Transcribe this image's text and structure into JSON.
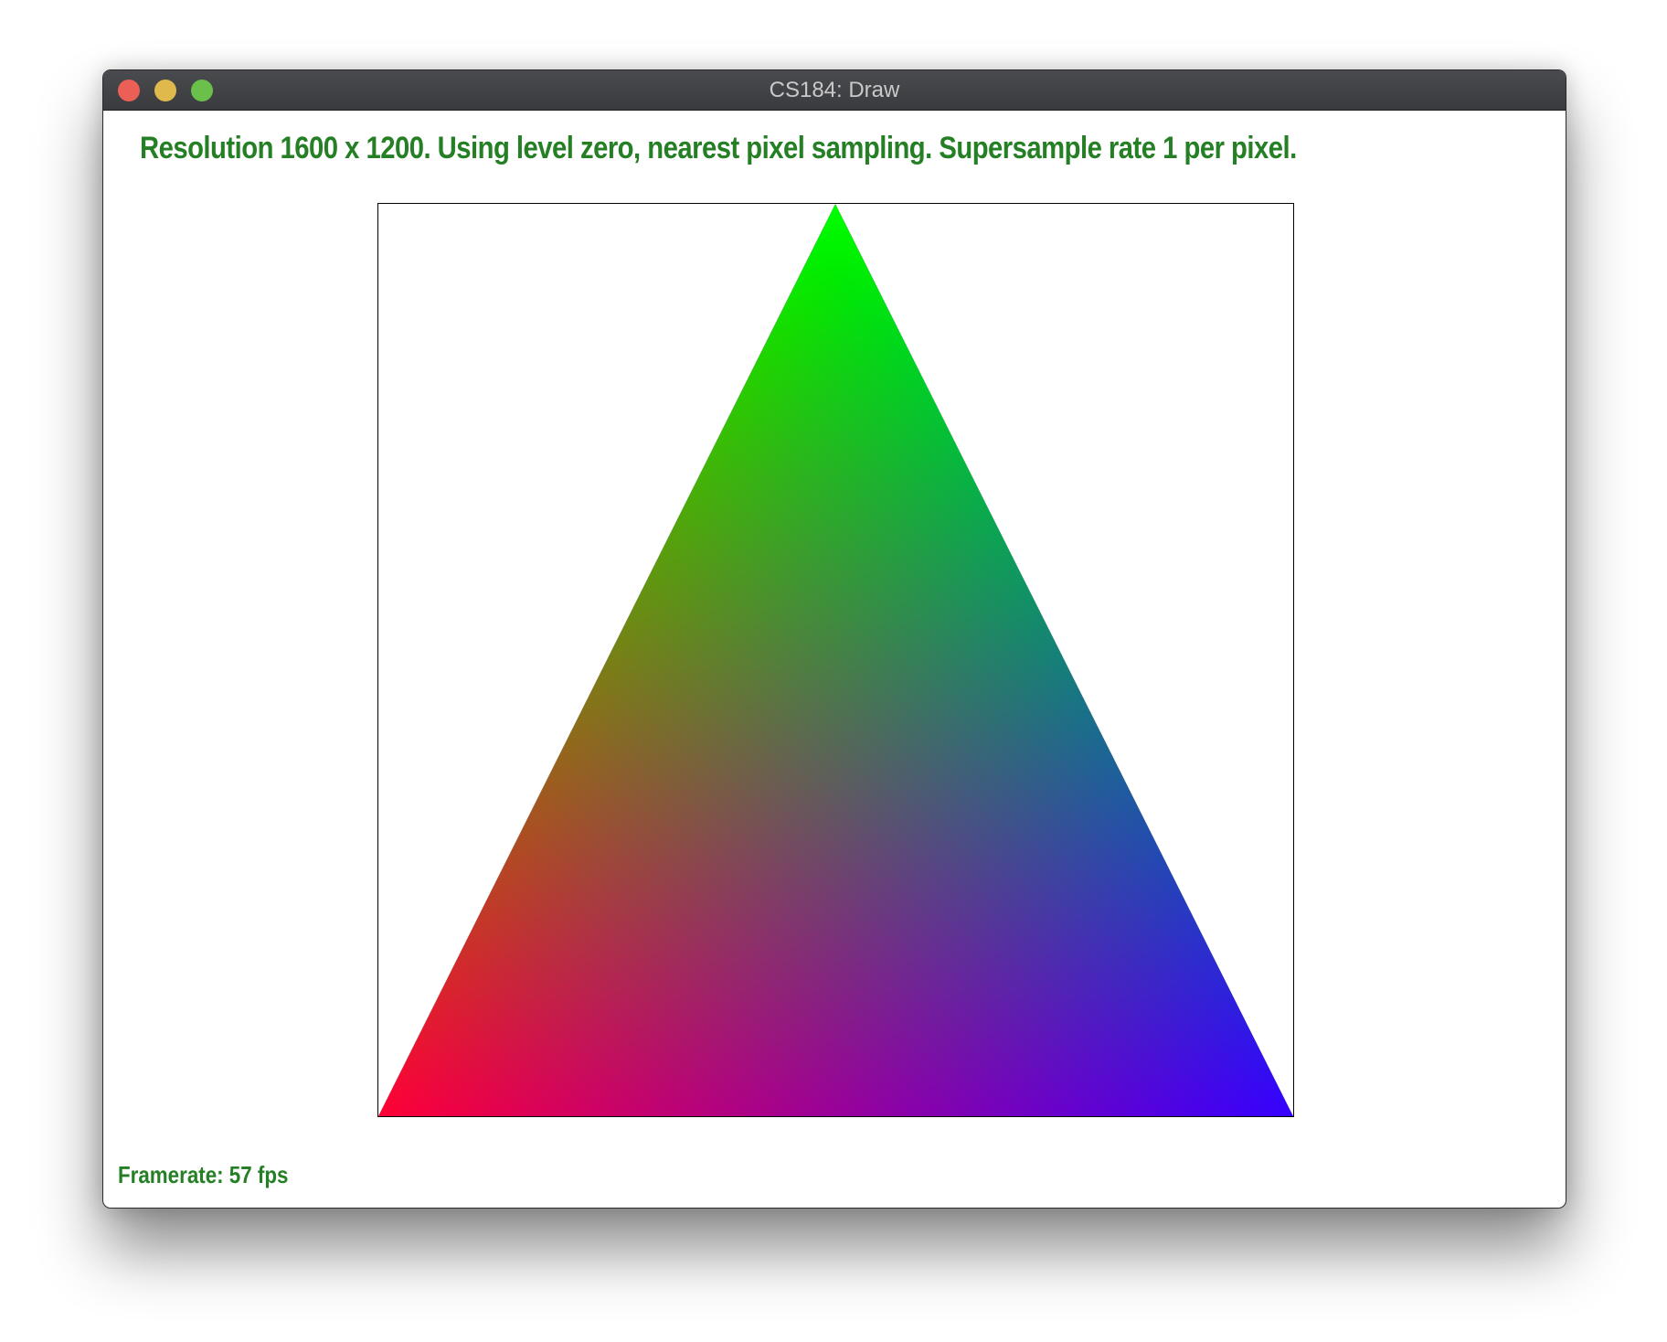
{
  "window": {
    "title": "CS184: Draw"
  },
  "status": {
    "text": "Resolution 1600 x 1200. Using level zero, nearest pixel sampling. Supersample rate 1 per pixel."
  },
  "footer": {
    "framerate_text": "Framerate: 57 fps"
  },
  "colors": {
    "status_text": "#257f25",
    "titlebar": "#3d3e41",
    "close_button": "#ec5f57",
    "minimize_button": "#e0b94c",
    "maximize_button": "#6ac04a",
    "triangle_top_vertex": "#00ff00",
    "triangle_bottom_left_vertex": "#ff0000",
    "triangle_bottom_right_vertex": "#0000ff"
  }
}
